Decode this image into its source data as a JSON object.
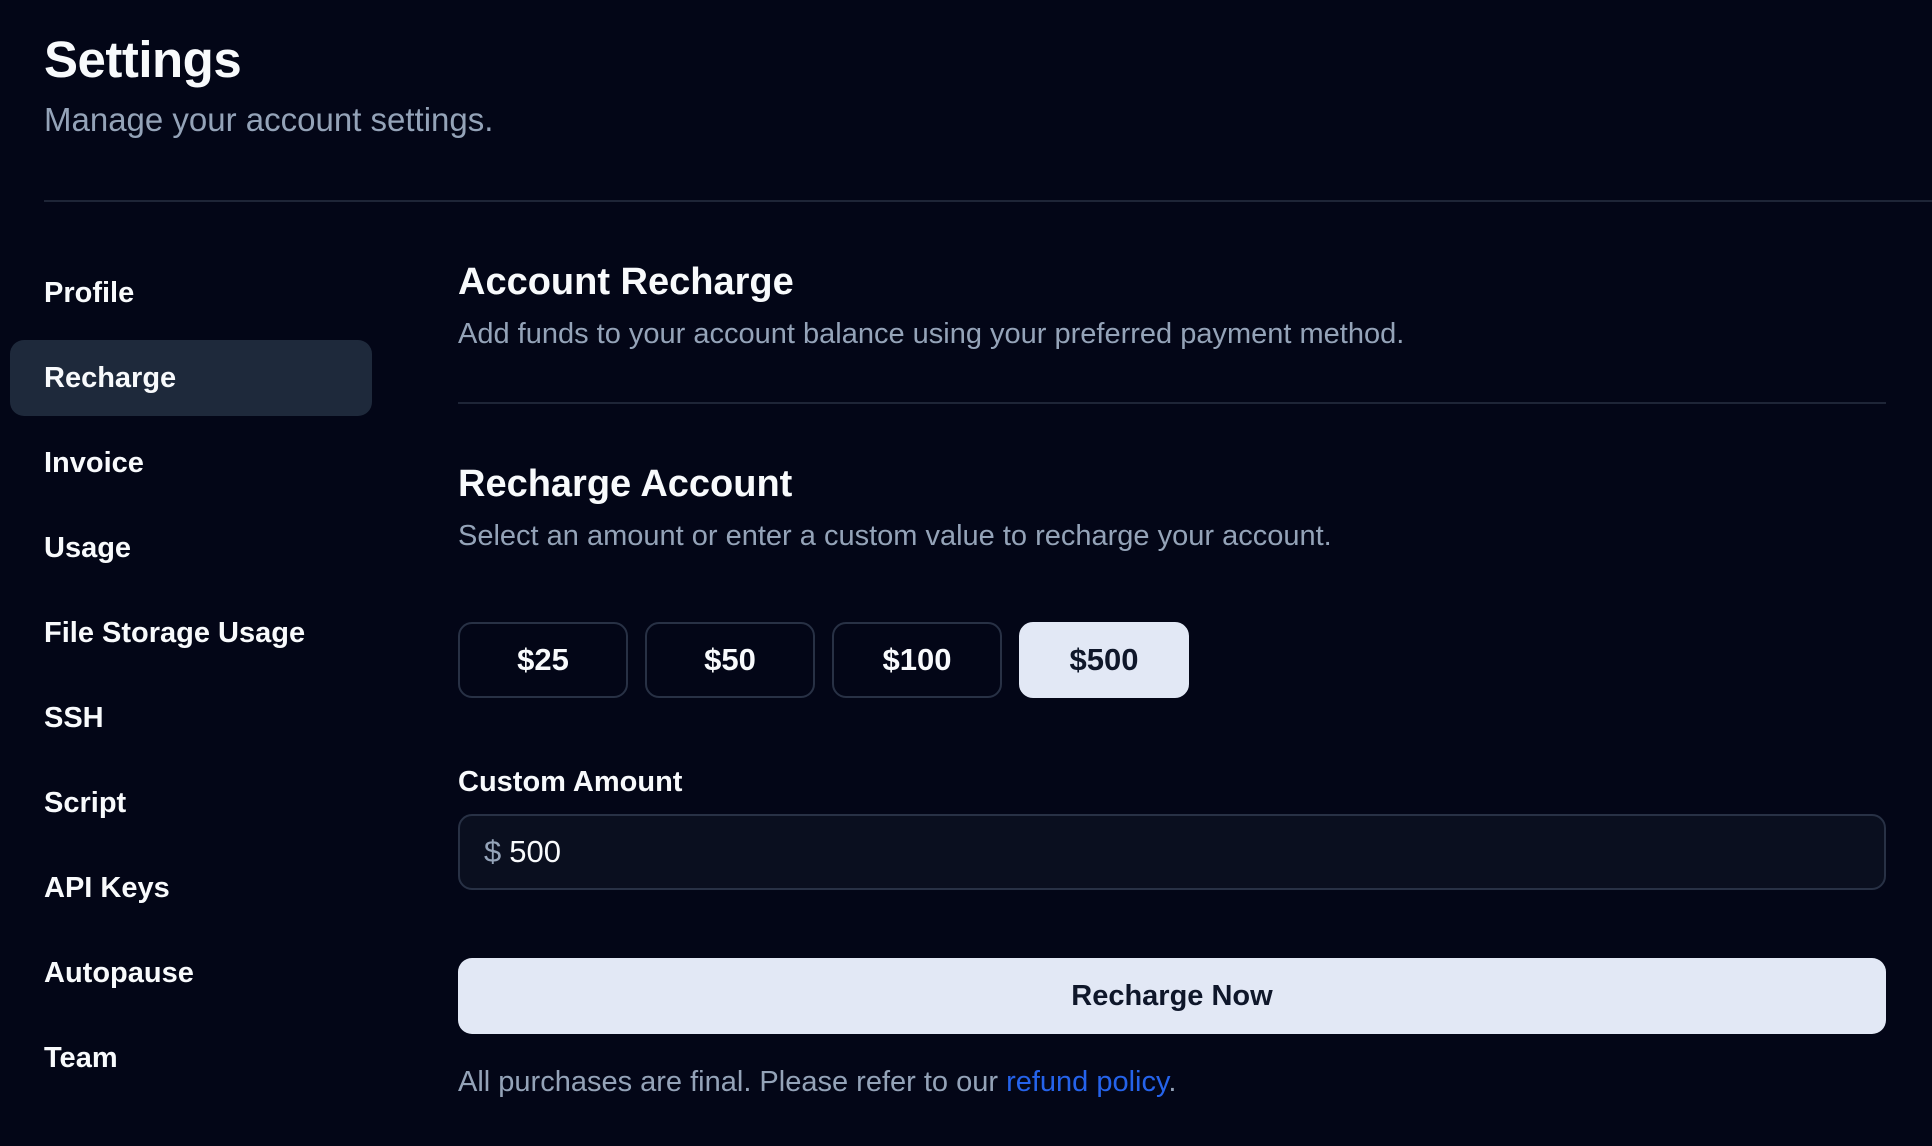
{
  "header": {
    "title": "Settings",
    "subtitle": "Manage your account settings."
  },
  "sidebar": {
    "items": [
      {
        "label": "Profile"
      },
      {
        "label": "Recharge",
        "active": true
      },
      {
        "label": "Invoice"
      },
      {
        "label": "Usage"
      },
      {
        "label": "File Storage Usage"
      },
      {
        "label": "SSH"
      },
      {
        "label": "Script"
      },
      {
        "label": "API Keys"
      },
      {
        "label": "Autopause"
      },
      {
        "label": "Team"
      }
    ]
  },
  "account_recharge": {
    "title": "Account Recharge",
    "description": "Add funds to your account balance using your preferred payment method."
  },
  "recharge_account": {
    "title": "Recharge Account",
    "description": "Select an amount or enter a custom value to recharge your account.",
    "amounts": [
      "$25",
      "$50",
      "$100",
      "$500"
    ],
    "selected_amount": "$500"
  },
  "custom_amount": {
    "label": "Custom Amount",
    "currency_symbol": "$",
    "value": "500"
  },
  "recharge_button": {
    "label": "Recharge Now"
  },
  "footer": {
    "text": "All purchases are final. Please refer to our ",
    "link_text": "refund policy",
    "suffix": "."
  },
  "colors": {
    "background": "#030617",
    "active_nav": "#1e293b",
    "muted_text": "#94a3b8",
    "button_light": "#e2e8f5",
    "link": "#2563eb"
  }
}
